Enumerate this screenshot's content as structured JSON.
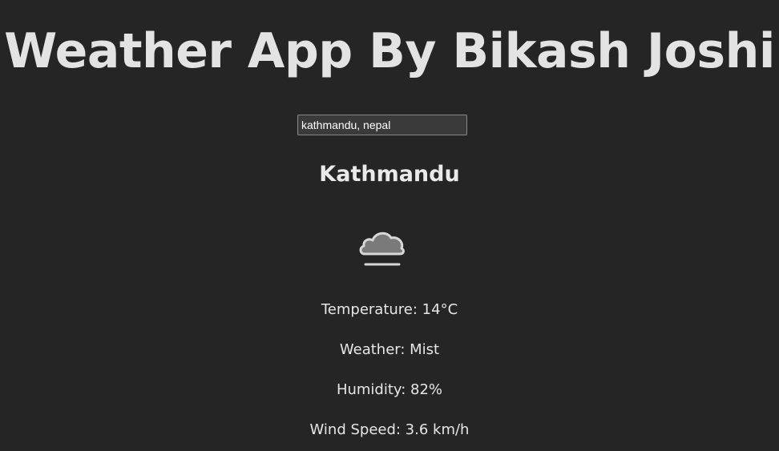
{
  "header": {
    "title": "Weather App By Bikash Joshi"
  },
  "search": {
    "value": "kathmandu, nepal"
  },
  "weather": {
    "city": "Kathmandu",
    "icon": "mist-cloud-icon",
    "temperature": "Temperature: 14°C",
    "condition": "Weather: Mist",
    "humidity": "Humidity: 82%",
    "wind_speed": "Wind Speed: 3.6 km/h"
  },
  "colors": {
    "background": "#252525",
    "text": "#e6e6e6",
    "icon": "#8c8c8c"
  }
}
